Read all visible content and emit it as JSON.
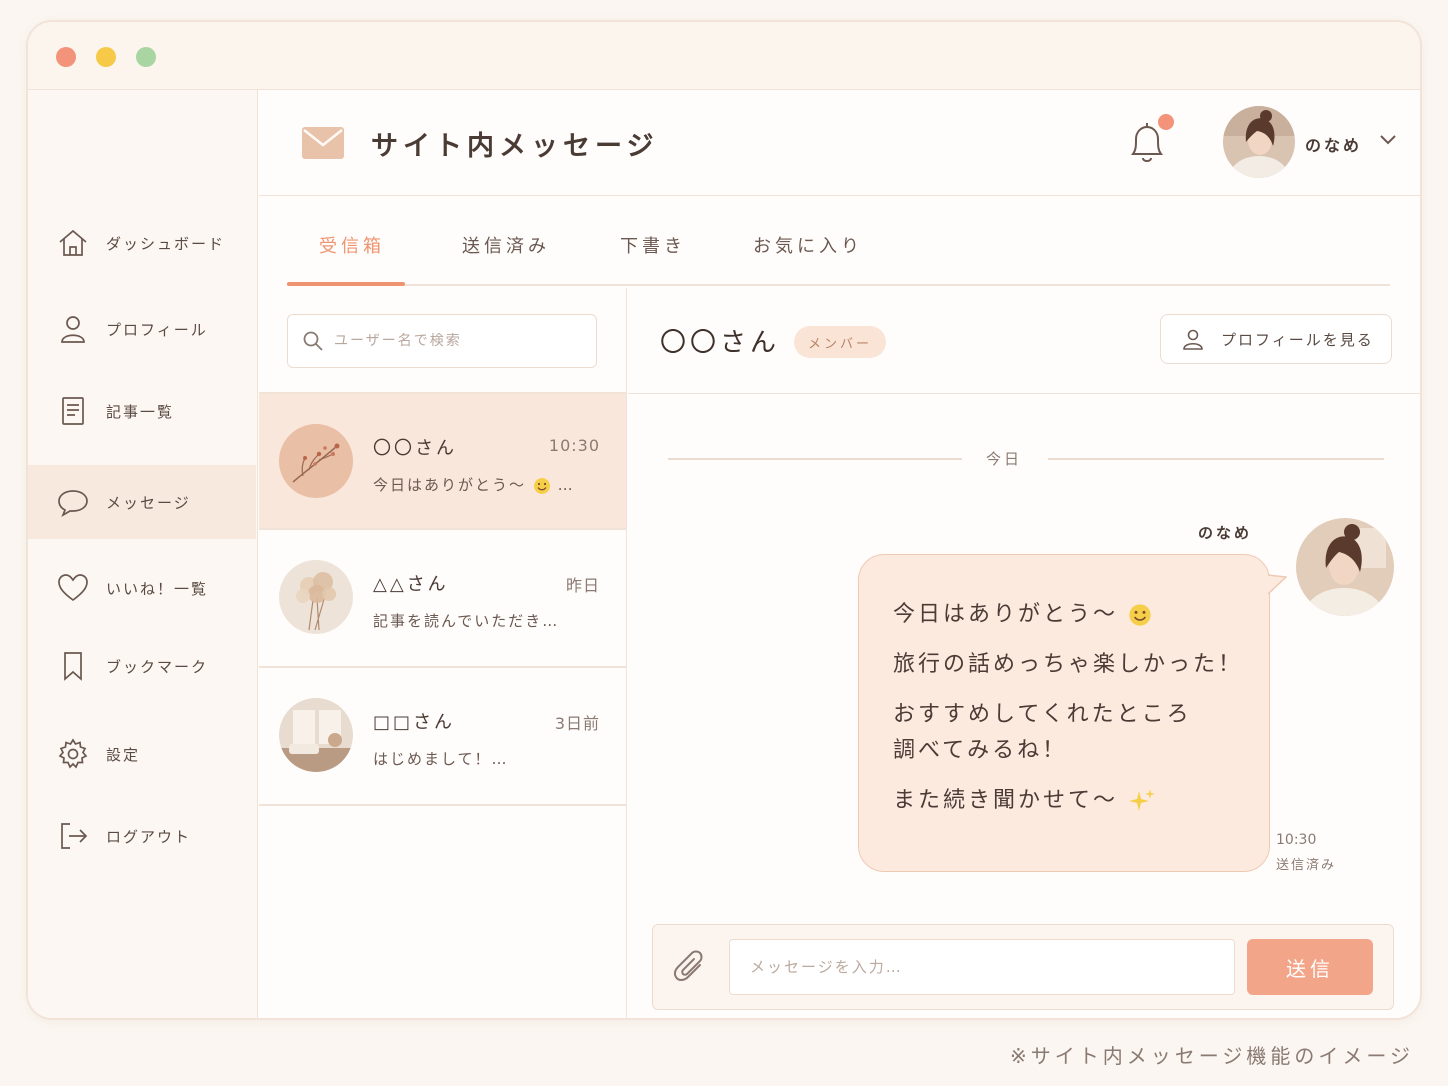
{
  "window": {
    "title": "サイト内メッセージ"
  },
  "sidebar": {
    "items": [
      {
        "label": "ダッシュボード",
        "icon": "home-icon"
      },
      {
        "label": "プロフィール",
        "icon": "user-icon"
      },
      {
        "label": "記事一覧",
        "icon": "document-icon"
      },
      {
        "label": "メッセージ",
        "icon": "chat-bubble-icon",
        "active": true
      },
      {
        "label": "いいね！一覧",
        "icon": "heart-icon"
      },
      {
        "label": "ブックマーク",
        "icon": "bookmark-icon"
      },
      {
        "label": "設定",
        "icon": "gear-icon"
      },
      {
        "label": "ログアウト",
        "icon": "logout-icon"
      }
    ]
  },
  "header": {
    "title": "サイト内メッセージ",
    "user_name": "のなめ",
    "has_notification": true
  },
  "tabs": [
    {
      "label": "受信箱",
      "active": true
    },
    {
      "label": "送信済み"
    },
    {
      "label": "下書き"
    },
    {
      "label": "お気に入り"
    }
  ],
  "search": {
    "placeholder": "ユーザー名で検索",
    "value": ""
  },
  "conversations": [
    {
      "name": "〇〇さん",
      "time": "10:30",
      "preview": "今日はありがとう～",
      "preview_suffix": " …",
      "active": true
    },
    {
      "name": "△△さん",
      "time": "昨日",
      "preview": "記事を読んでいただき…"
    },
    {
      "name": "□□さん",
      "time": "3日前",
      "preview": "はじめまして！…"
    }
  ],
  "chat": {
    "partner_name": "〇〇さん",
    "partner_badge": "メンバー",
    "profile_button": "プロフィールを見る",
    "day_separator": "今日",
    "message": {
      "sender": "のなめ",
      "line1": "今日はありがとう～",
      "line2": "旅行の話めっちゃ楽しかった！",
      "line3": "おすすめしてくれたところ",
      "line4": "調べてみるね！",
      "line5": "また続き聞かせて～",
      "time": "10:30",
      "status": "送信済み"
    }
  },
  "composer": {
    "placeholder": "メッセージを入力…",
    "value": "",
    "send_label": "送信"
  },
  "caption": "※サイト内メッセージ機能のイメージ",
  "colors": {
    "accent": "#ee9470",
    "send_button": "#f3a589",
    "bubble": "#fdeadf",
    "active_row": "#fae7dc"
  }
}
